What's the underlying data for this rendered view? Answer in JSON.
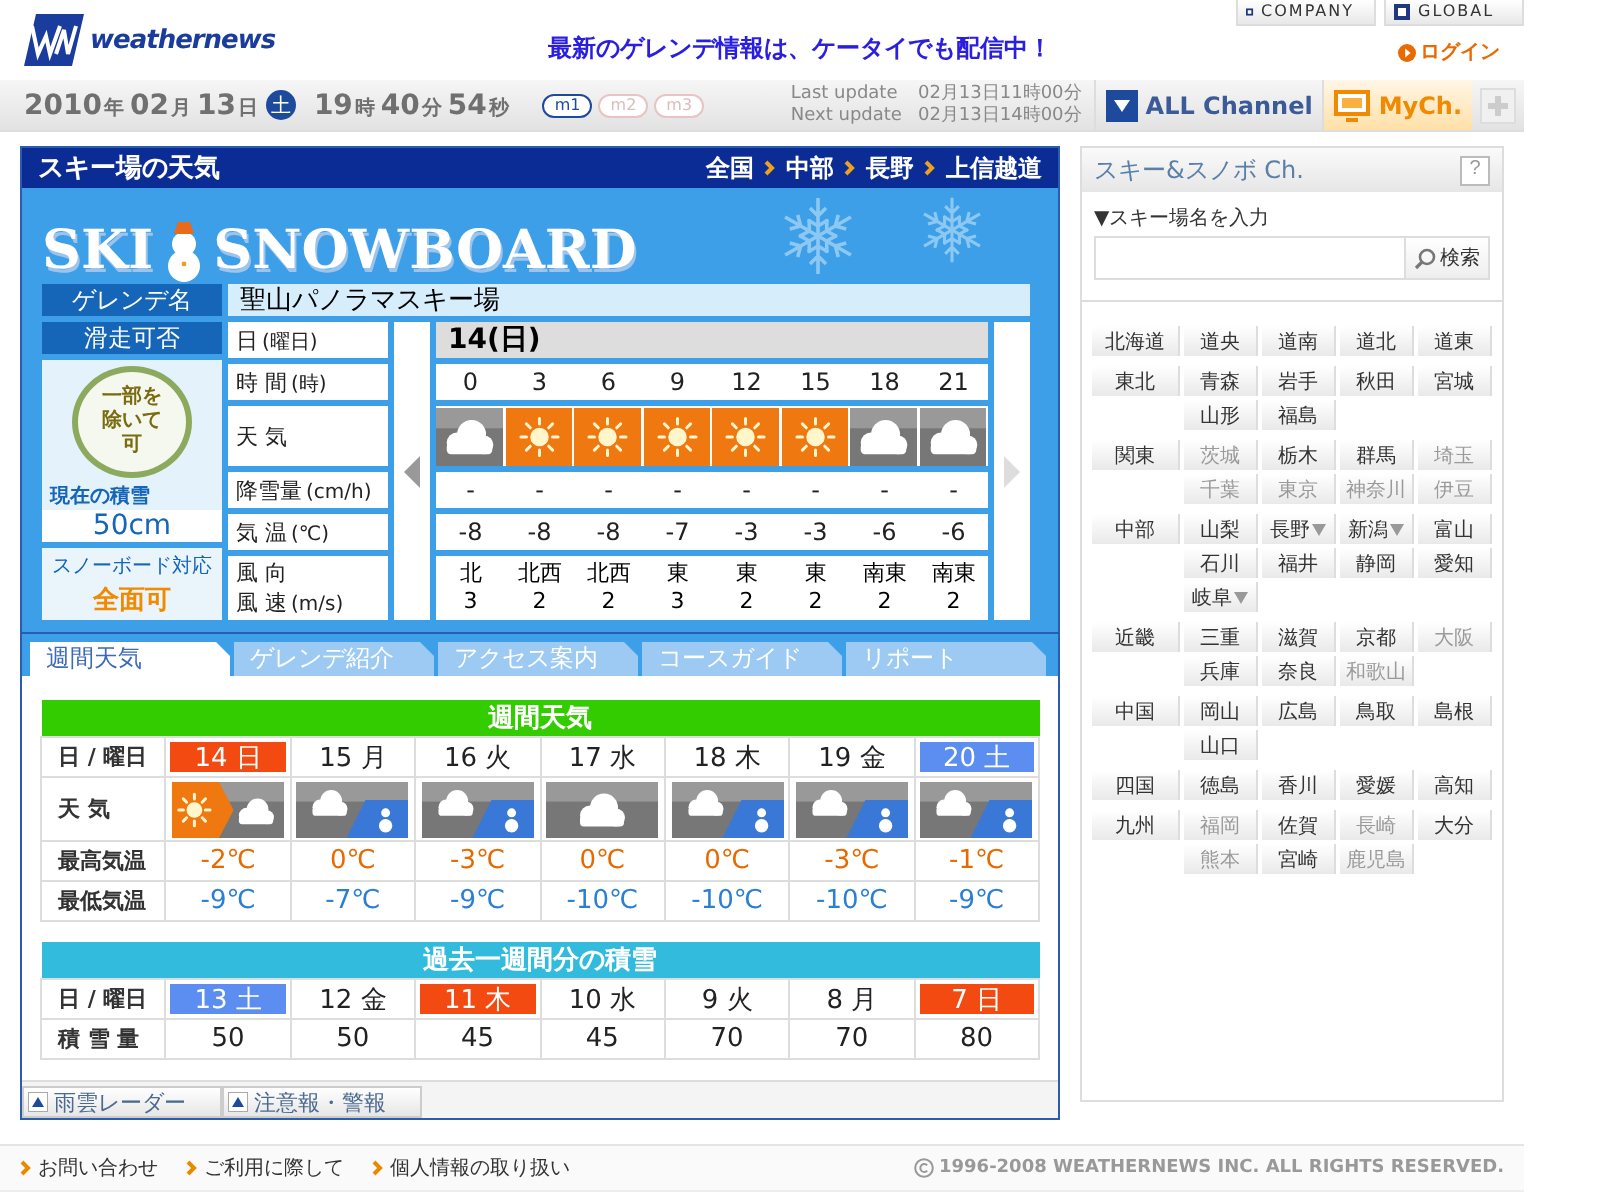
{
  "header": {
    "logo": "weathernews",
    "links": [
      "COMPANY",
      "GLOBAL"
    ],
    "banner": "最新のゲレンデ情報は、ケータイでも配信中！",
    "login": "ログイン"
  },
  "clock": {
    "date": [
      {
        "value": "2010",
        "unit": "年"
      },
      {
        "value": "02",
        "unit": "月"
      },
      {
        "value": "13",
        "unit": "日"
      }
    ],
    "weekday": "土",
    "time": [
      {
        "value": "19",
        "unit": "時"
      },
      {
        "value": "40",
        "unit": "分"
      },
      {
        "value": "54",
        "unit": "秒"
      }
    ]
  },
  "modes": [
    {
      "label": "m1",
      "selected": true
    },
    {
      "label": "m2",
      "selected": false
    },
    {
      "label": "m3",
      "selected": false
    }
  ],
  "updates": [
    {
      "label": "Last update",
      "value": "02月13日11時00分"
    },
    {
      "label": "Next update",
      "value": "02月13日14時00分"
    }
  ],
  "channels": [
    {
      "kind": "all",
      "label": "ALL Channel"
    },
    {
      "kind": "my",
      "label": "MyCh."
    }
  ],
  "ski_weather": {
    "title": "スキー場の天気",
    "breadcrumb": [
      "全国",
      "中部",
      "長野",
      "上信越道"
    ],
    "logo": [
      "SKI",
      "SNOWBOARD"
    ],
    "resort_label": "ゲレンデ名",
    "resort": "聖山パノラマスキー場",
    "status_label": "滑走可否",
    "status": "一部を除いて可",
    "depth_label": "現在の積雪",
    "depth": "50cm",
    "snowboard_label": "スノーボード対応",
    "snowboard": "全面可",
    "row_labels": [
      {
        "main": "日",
        "sub": "(曜日)"
      },
      {
        "main": "時 間",
        "sub": "(時)"
      },
      {
        "main": "天 気"
      },
      {
        "main": "降雪量",
        "sub": "(cm/h)"
      },
      {
        "main": "気 温",
        "sub": "(℃)"
      },
      {
        "main": "風 向",
        "main2": "風 速",
        "sub": "(m/s)"
      }
    ],
    "day": "14(日)",
    "hours": [
      {
        "time": "0",
        "kind": "cloud",
        "snow": "-",
        "temp": "-8",
        "wind_dir": "北",
        "wind_speed": "3"
      },
      {
        "time": "3",
        "kind": "sun",
        "snow": "-",
        "temp": "-8",
        "wind_dir": "北西",
        "wind_speed": "2"
      },
      {
        "time": "6",
        "kind": "sun",
        "snow": "-",
        "temp": "-8",
        "wind_dir": "北西",
        "wind_speed": "2"
      },
      {
        "time": "9",
        "kind": "sun",
        "snow": "-",
        "temp": "-7",
        "wind_dir": "東",
        "wind_speed": "3"
      },
      {
        "time": "12",
        "kind": "sun",
        "snow": "-",
        "temp": "-3",
        "wind_dir": "東",
        "wind_speed": "2"
      },
      {
        "time": "15",
        "kind": "sun",
        "snow": "-",
        "temp": "-3",
        "wind_dir": "東",
        "wind_speed": "2"
      },
      {
        "time": "18",
        "kind": "cloud",
        "snow": "-",
        "temp": "-6",
        "wind_dir": "南東",
        "wind_speed": "2"
      },
      {
        "time": "21",
        "kind": "cloud",
        "snow": "-",
        "temp": "-6",
        "wind_dir": "南東",
        "wind_speed": "2"
      }
    ]
  },
  "tabs": [
    {
      "label": "週間天気",
      "selected": true
    },
    {
      "label": "ゲレンデ紹介",
      "selected": false
    },
    {
      "label": "アクセス案内",
      "selected": false
    },
    {
      "label": "コースガイド",
      "selected": false
    },
    {
      "label": "リポート",
      "selected": false
    }
  ],
  "weekly": {
    "title": "週間天気",
    "labels": [
      "日 / 曜日",
      "天 気",
      "最高気温",
      "最低気温"
    ],
    "days": [
      {
        "date": "14 日",
        "holiday": true,
        "saturday": false,
        "kind": "sun_cloud",
        "high": "-2℃",
        "low": "-9℃"
      },
      {
        "date": "15 月",
        "holiday": false,
        "saturday": false,
        "kind": "cloud_snow",
        "high": "0℃",
        "low": "-7℃"
      },
      {
        "date": "16 火",
        "holiday": false,
        "saturday": false,
        "kind": "cloud_snow",
        "high": "-3℃",
        "low": "-9℃"
      },
      {
        "date": "17 水",
        "holiday": false,
        "saturday": false,
        "kind": "cloud",
        "high": "0℃",
        "low": "-10℃"
      },
      {
        "date": "18 木",
        "holiday": false,
        "saturday": false,
        "kind": "cloud_snow",
        "high": "0℃",
        "low": "-10℃"
      },
      {
        "date": "19 金",
        "holiday": false,
        "saturday": false,
        "kind": "cloud_snow",
        "high": "-3℃",
        "low": "-10℃"
      },
      {
        "date": "20 土",
        "holiday": false,
        "saturday": true,
        "kind": "cloud_snow",
        "high": "-1℃",
        "low": "-9℃"
      }
    ]
  },
  "snow_history": {
    "title": "過去一週間分の積雪",
    "labels": [
      "日 / 曜日",
      "積 雪 量"
    ],
    "days": [
      {
        "date": "13 土",
        "holiday": false,
        "saturday": true,
        "depth": "50"
      },
      {
        "date": "12 金",
        "holiday": false,
        "saturday": false,
        "depth": "50"
      },
      {
        "date": "11 木",
        "holiday": true,
        "saturday": false,
        "depth": "45"
      },
      {
        "date": "10 水",
        "holiday": false,
        "saturday": false,
        "depth": "45"
      },
      {
        "date": "9 火",
        "holiday": false,
        "saturday": false,
        "depth": "70"
      },
      {
        "date": "8 月",
        "holiday": false,
        "saturday": false,
        "depth": "70"
      },
      {
        "date": "7 日",
        "holiday": true,
        "saturday": false,
        "depth": "80"
      }
    ]
  },
  "bottom_links": [
    "雨雲レーダー",
    "注意報・警報"
  ],
  "sidebar": {
    "title": "スキー&スノボ Ch.",
    "help": "?",
    "search_label": "▼スキー場名を入力",
    "search_button": "検索",
    "regions": [
      {
        "name": "北海道",
        "prefectures": [
          {
            "name": "道央",
            "disabled": false,
            "dropdown": false
          },
          {
            "name": "道南",
            "disabled": false,
            "dropdown": false
          },
          {
            "name": "道北",
            "disabled": false,
            "dropdown": false
          },
          {
            "name": "道東",
            "disabled": false,
            "dropdown": false
          }
        ]
      },
      {
        "name": "東北",
        "prefectures": [
          {
            "name": "青森",
            "disabled": false,
            "dropdown": false
          },
          {
            "name": "岩手",
            "disabled": false,
            "dropdown": false
          },
          {
            "name": "秋田",
            "disabled": false,
            "dropdown": false
          },
          {
            "name": "宮城",
            "disabled": false,
            "dropdown": false
          },
          {
            "name": "山形",
            "disabled": false,
            "dropdown": false
          },
          {
            "name": "福島",
            "disabled": false,
            "dropdown": false
          }
        ]
      },
      {
        "name": "関東",
        "prefectures": [
          {
            "name": "茨城",
            "disabled": true,
            "dropdown": false
          },
          {
            "name": "栃木",
            "disabled": false,
            "dropdown": false
          },
          {
            "name": "群馬",
            "disabled": false,
            "dropdown": false
          },
          {
            "name": "埼玉",
            "disabled": true,
            "dropdown": false
          },
          {
            "name": "千葉",
            "disabled": true,
            "dropdown": false
          },
          {
            "name": "東京",
            "disabled": true,
            "dropdown": false
          },
          {
            "name": "神奈川",
            "disabled": true,
            "dropdown": false
          },
          {
            "name": "伊豆",
            "disabled": true,
            "dropdown": false
          }
        ]
      },
      {
        "name": "中部",
        "prefectures": [
          {
            "name": "山梨",
            "disabled": false,
            "dropdown": false
          },
          {
            "name": "長野",
            "disabled": false,
            "dropdown": true
          },
          {
            "name": "新潟",
            "disabled": false,
            "dropdown": true
          },
          {
            "name": "富山",
            "disabled": false,
            "dropdown": false
          },
          {
            "name": "石川",
            "disabled": false,
            "dropdown": false
          },
          {
            "name": "福井",
            "disabled": false,
            "dropdown": false
          },
          {
            "name": "静岡",
            "disabled": false,
            "dropdown": false
          },
          {
            "name": "愛知",
            "disabled": false,
            "dropdown": false
          },
          {
            "name": "岐阜",
            "disabled": false,
            "dropdown": true
          }
        ]
      },
      {
        "name": "近畿",
        "prefectures": [
          {
            "name": "三重",
            "disabled": false,
            "dropdown": false
          },
          {
            "name": "滋賀",
            "disabled": false,
            "dropdown": false
          },
          {
            "name": "京都",
            "disabled": false,
            "dropdown": false
          },
          {
            "name": "大阪",
            "disabled": true,
            "dropdown": false
          },
          {
            "name": "兵庫",
            "disabled": false,
            "dropdown": false
          },
          {
            "name": "奈良",
            "disabled": false,
            "dropdown": false
          },
          {
            "name": "和歌山",
            "disabled": true,
            "dropdown": false
          }
        ]
      },
      {
        "name": "中国",
        "prefectures": [
          {
            "name": "岡山",
            "disabled": false,
            "dropdown": false
          },
          {
            "name": "広島",
            "disabled": false,
            "dropdown": false
          },
          {
            "name": "鳥取",
            "disabled": false,
            "dropdown": false
          },
          {
            "name": "島根",
            "disabled": false,
            "dropdown": false
          },
          {
            "name": "山口",
            "disabled": false,
            "dropdown": false
          }
        ]
      },
      {
        "name": "四国",
        "prefectures": [
          {
            "name": "徳島",
            "disabled": false,
            "dropdown": false
          },
          {
            "name": "香川",
            "disabled": false,
            "dropdown": false
          },
          {
            "name": "愛媛",
            "disabled": false,
            "dropdown": false
          },
          {
            "name": "高知",
            "disabled": false,
            "dropdown": false
          }
        ]
      },
      {
        "name": "九州",
        "prefectures": [
          {
            "name": "福岡",
            "disabled": true,
            "dropdown": false
          },
          {
            "name": "佐賀",
            "disabled": false,
            "dropdown": false
          },
          {
            "name": "長崎",
            "disabled": true,
            "dropdown": false
          },
          {
            "name": "大分",
            "disabled": false,
            "dropdown": false
          },
          {
            "name": "熊本",
            "disabled": true,
            "dropdown": false
          },
          {
            "name": "宮崎",
            "disabled": false,
            "dropdown": false
          },
          {
            "name": "鹿児島",
            "disabled": true,
            "dropdown": false
          }
        ]
      }
    ]
  },
  "footer": {
    "links": [
      "お問い合わせ",
      "ご利用に際して",
      "個人情報の取り扱い"
    ],
    "copyright": "1996-2008 WEATHERNEWS INC. ALL RIGHTS RESERVED."
  }
}
